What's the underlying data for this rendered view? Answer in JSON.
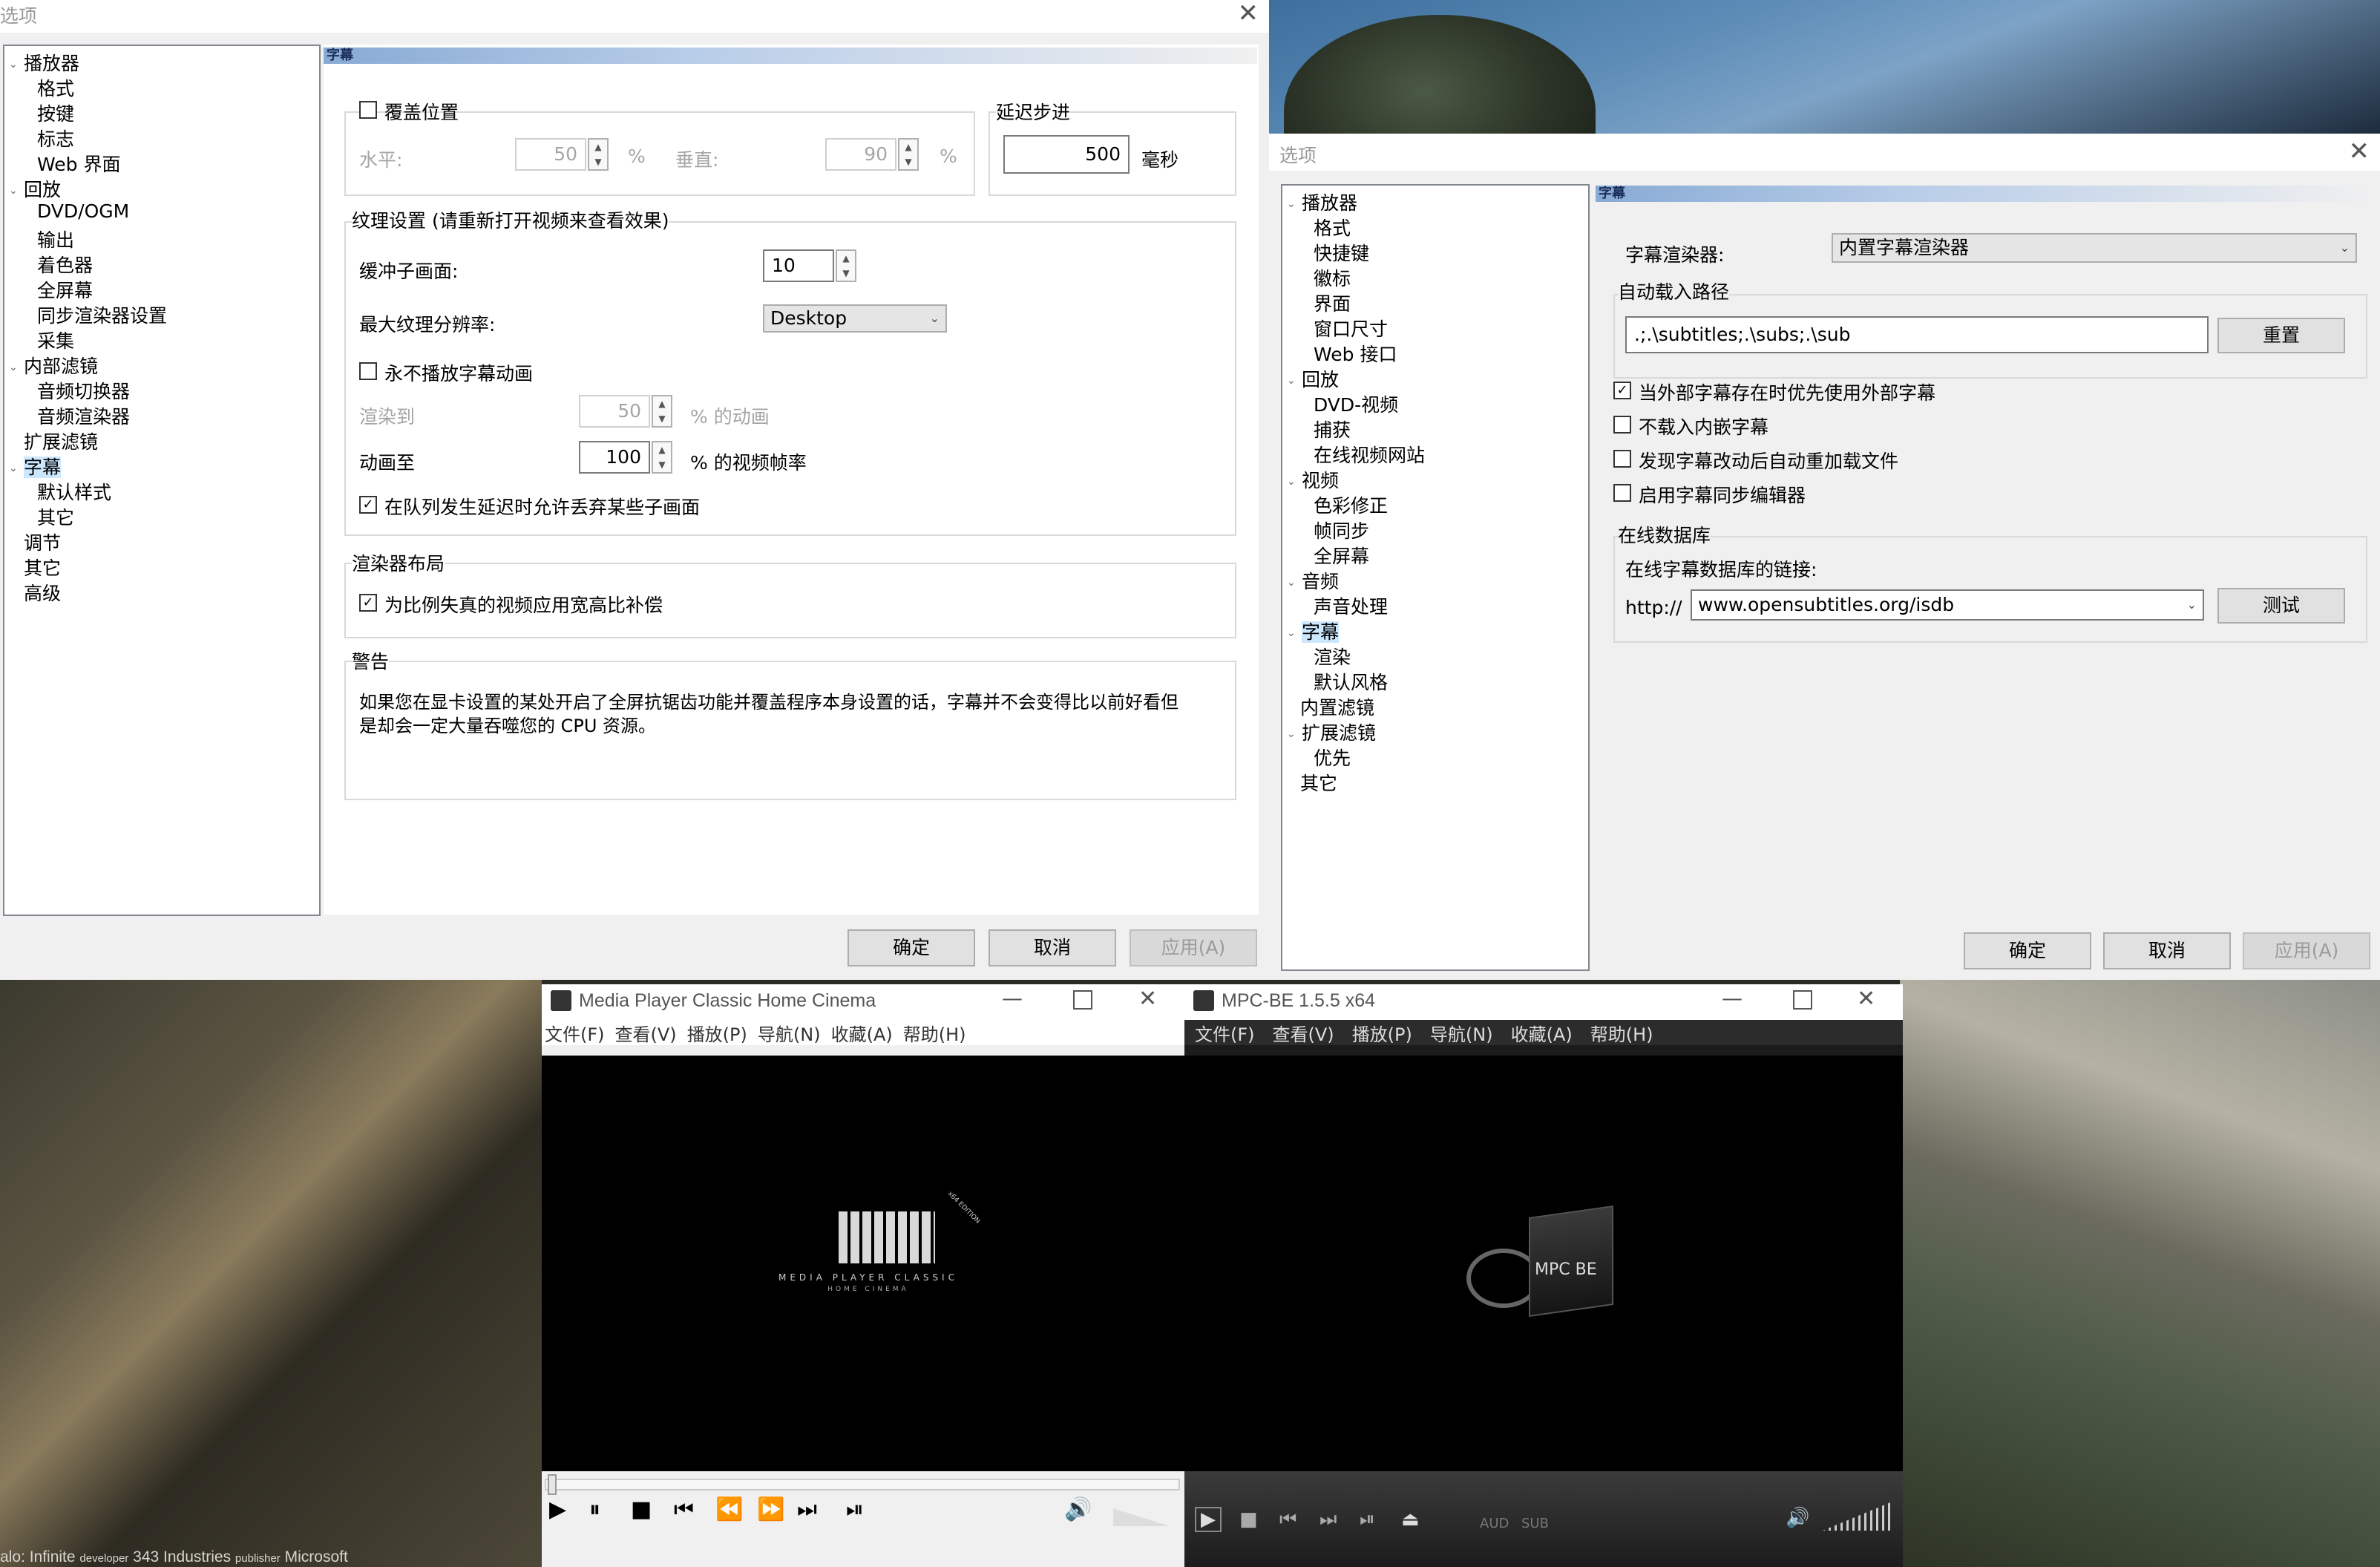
{
  "wallpaper": {
    "caption_game": "alo: Infinite",
    "caption_dev_label": "developer",
    "caption_dev": "343 Industries",
    "caption_pub_label": "publisher",
    "caption_pub": "Microsoft"
  },
  "dialog1": {
    "title": "选项",
    "close": "✕",
    "tree": {
      "player": "播放器",
      "format": "格式",
      "keys": "按键",
      "logo": "标志",
      "web": "Web 界面",
      "playback": "回放",
      "dvd": "DVD/OGM",
      "output": "输出",
      "shaders": "着色器",
      "fullscreen": "全屏幕",
      "sync": "同步渲染器设置",
      "capture": "采集",
      "internal": "内部滤镜",
      "audio_switch": "音频切换器",
      "audio_renderer": "音频渲染器",
      "external": "扩展滤镜",
      "subtitles": "字幕",
      "default_style": "默认样式",
      "misc": "其它",
      "tweaks": "调节",
      "other": "其它",
      "advanced": "高级"
    },
    "header": "字幕",
    "override_position": "覆盖位置",
    "horizontal_label": "水平:",
    "horizontal_value": "50",
    "percent": "%",
    "vertical_label": "垂直:",
    "vertical_value": "90",
    "delay_group": "延迟步进",
    "delay_value": "500",
    "delay_unit": "毫秒",
    "texture_group": "纹理设置 (请重新打开视频来查看效果)",
    "buffer_label": "缓冲子画面:",
    "buffer_value": "10",
    "max_res_label": "最大纹理分辨率:",
    "max_res_value": "Desktop",
    "never_animate": "永不播放字幕动画",
    "render_to_label": "渲染到",
    "render_to_value": "50",
    "render_to_suffix": "% 的动画",
    "animate_at_label": "动画至",
    "animate_at_value": "100",
    "animate_at_suffix": "% 的视频帧率",
    "allow_drop": "在队列发生延迟时允许丢弃某些子画面",
    "layout_group": "渲染器布局",
    "aspect_comp": "为比例失真的视频应用宽高比补偿",
    "warning_group": "警告",
    "warning_text_1": "如果您在显卡设置的某处开启了全屏抗锯齿功能并覆盖程序本身设置的话，字幕并不会变得比以前好看但",
    "warning_text_2": "是却会一定大量吞噬您的 CPU 资源。",
    "ok": "确定",
    "cancel": "取消",
    "apply": "应用(A)"
  },
  "dialog2": {
    "title": "选项",
    "close": "✕",
    "tree": {
      "player": "播放器",
      "format": "格式",
      "hotkeys": "快捷键",
      "logo": "徽标",
      "ui": "界面",
      "window_size": "窗口尺寸",
      "web": "Web 接口",
      "playback": "回放",
      "dvd": "DVD-视频",
      "capture": "捕获",
      "online": "在线视频网站",
      "video": "视频",
      "color": "色彩修正",
      "frame_sync": "帧同步",
      "fullscreen": "全屏幕",
      "audio": "音频",
      "sound": "声音处理",
      "subtitles": "字幕",
      "render": "渲染",
      "default_style": "默认风格",
      "internal": "内置滤镜",
      "external": "扩展滤镜",
      "priority": "优先",
      "other": "其它"
    },
    "header": "字幕",
    "renderer_label": "字幕渲染器:",
    "renderer_value": "内置字幕渲染器",
    "autoload_group": "自动载入路径",
    "autoload_value": ".;.\\subtitles;.\\subs;.\\sub",
    "reset": "重置",
    "prefer_external": "当外部字幕存在时优先使用外部字幕",
    "no_embedded": "不载入内嵌字幕",
    "auto_reload": "发现字幕改动后自动重加载文件",
    "sync_editor": "启用字幕同步编辑器",
    "db_group": "在线数据库",
    "db_link_label": "在线字幕数据库的链接:",
    "http_prefix": "http://",
    "db_value": "www.opensubtitles.org/isdb",
    "test": "测试",
    "ok": "确定",
    "cancel": "取消",
    "apply": "应用(A)"
  },
  "mpchc": {
    "title": "Media Player Classic Home Cinema",
    "menu": [
      "文件(F)",
      "查看(V)",
      "播放(P)",
      "导航(N)",
      "收藏(A)",
      "帮助(H)"
    ],
    "logo_line1": "MEDIA PLAYER CLASSIC",
    "logo_line2": "HOME CINEMA",
    "logo_badge": "x64 EDITION",
    "icon": "clapper-icon"
  },
  "mpcbe": {
    "title": "MPC-BE 1.5.5 x64",
    "menu": [
      "文件(F)",
      "查看(V)",
      "播放(P)",
      "导航(N)",
      "收藏(A)",
      "帮助(H)"
    ],
    "logo_text": "MPC BE",
    "aud": "AUD",
    "sub": "SUB",
    "icon": "clapper-icon"
  },
  "colors": {
    "tree_selected": "#cce8ff",
    "header_blue": "#88aad4",
    "dark_player": "#2c2c2c"
  }
}
